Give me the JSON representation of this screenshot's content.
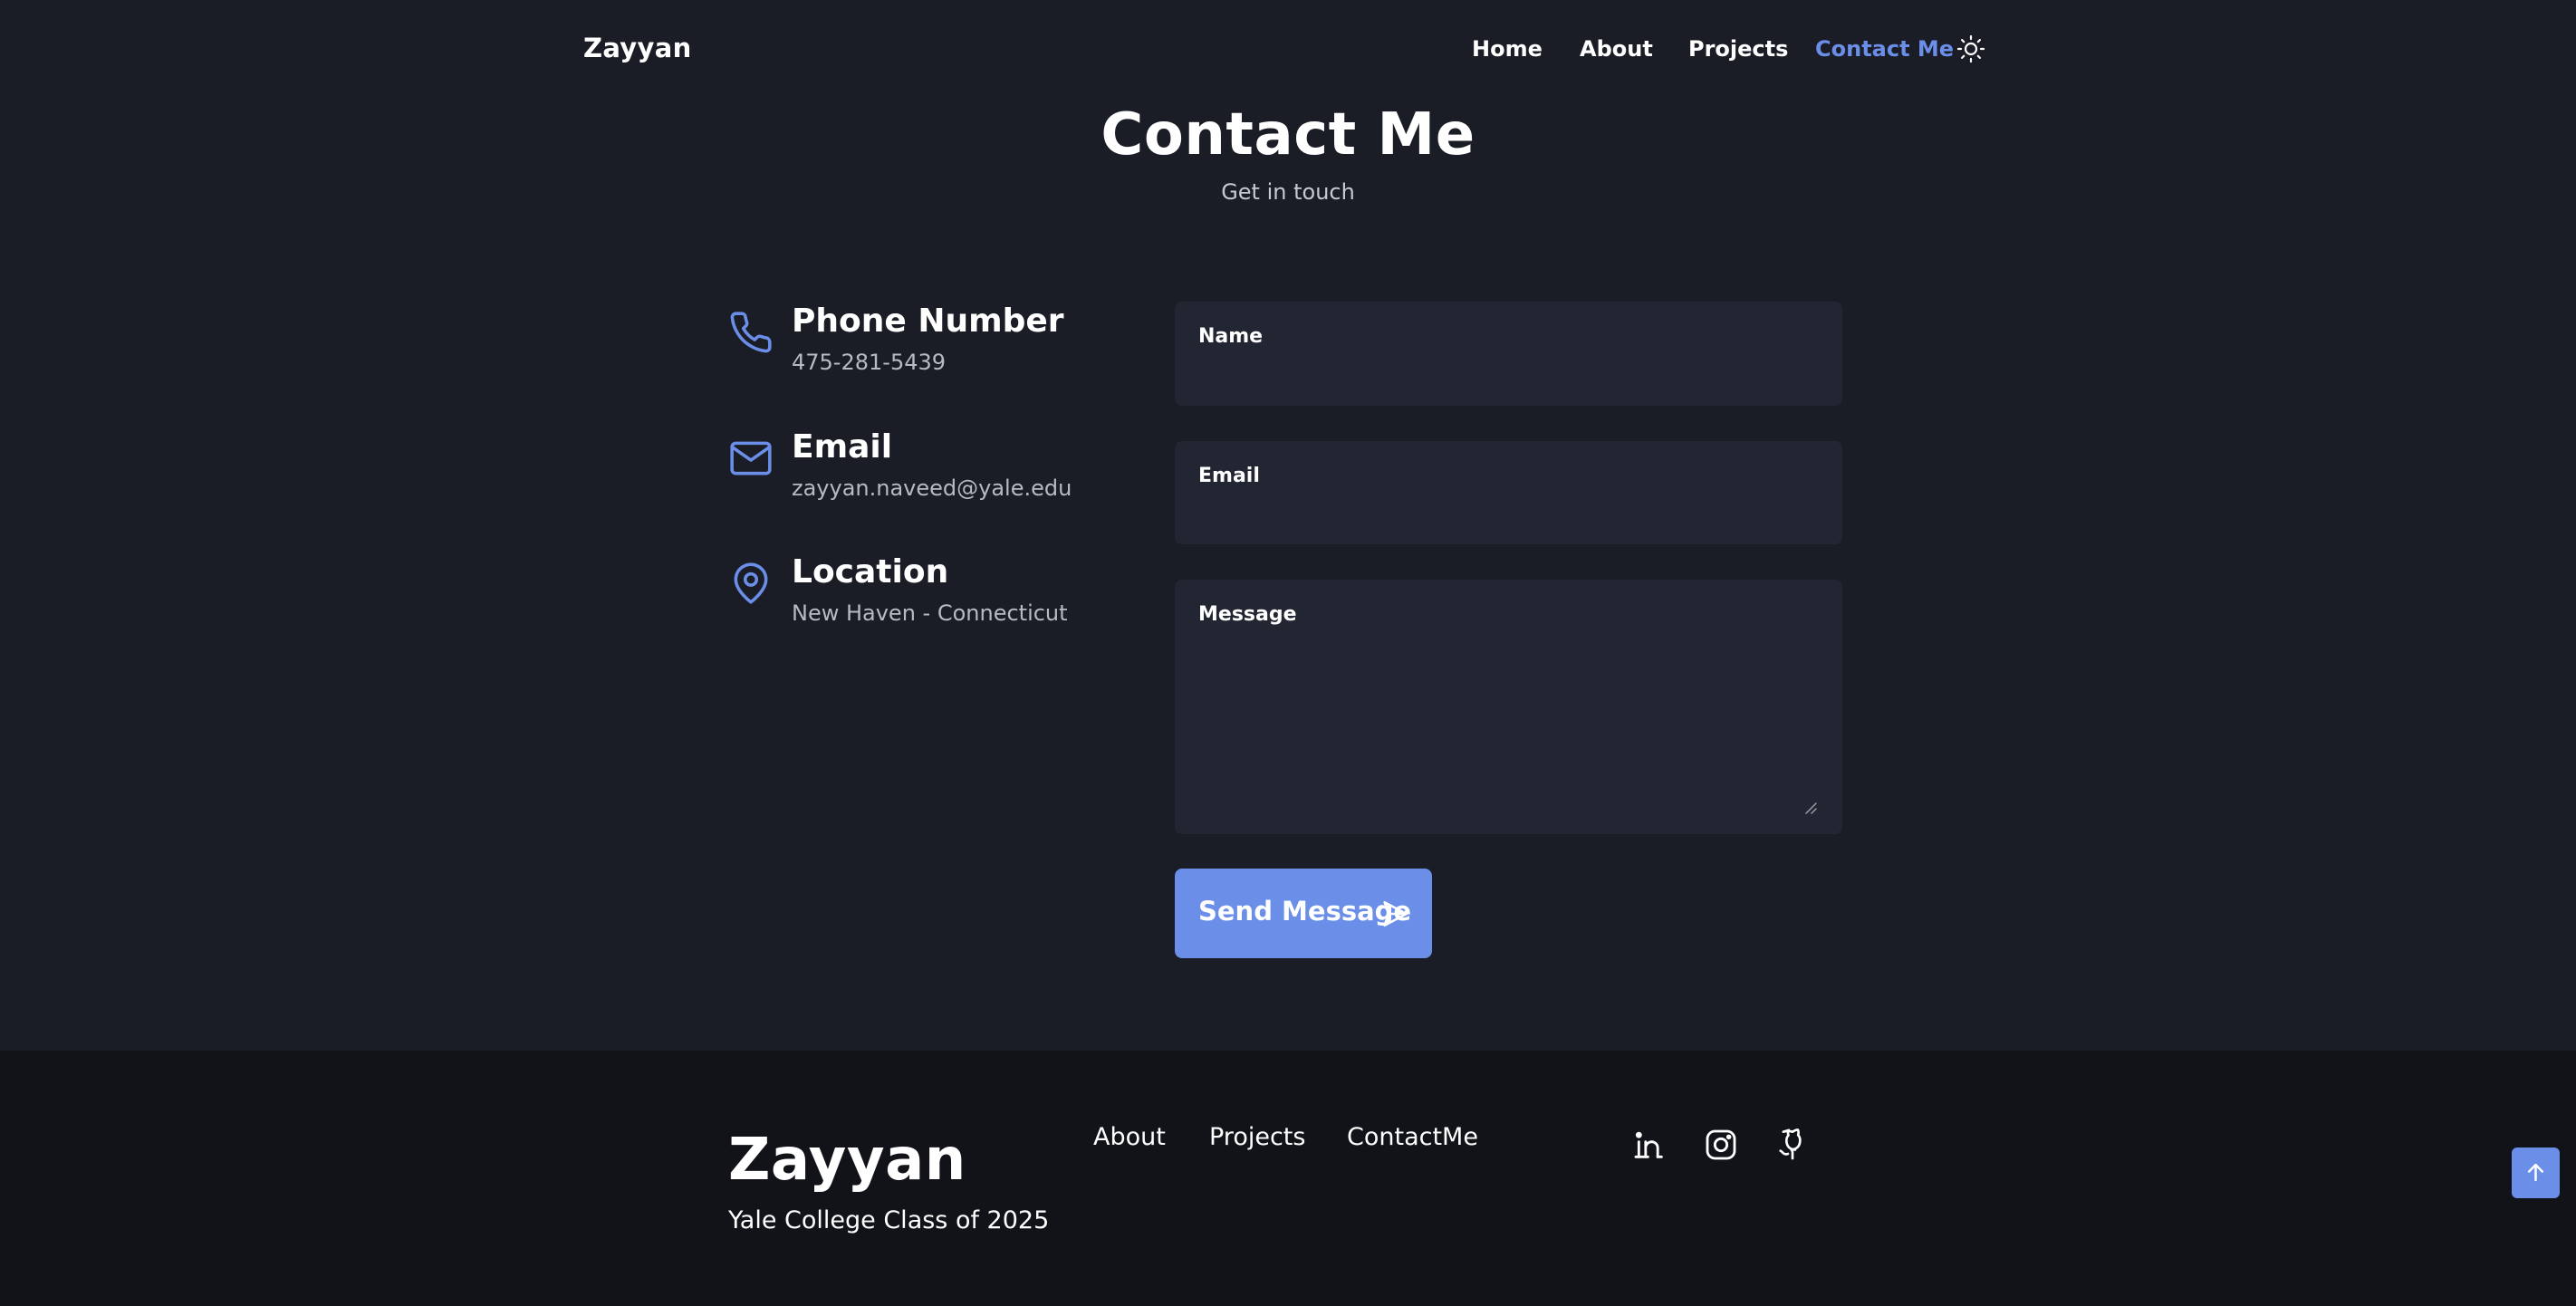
{
  "header": {
    "logo": "Zayyan",
    "nav": [
      {
        "label": "Home",
        "active": false
      },
      {
        "label": "About",
        "active": false
      },
      {
        "label": "Projects",
        "active": false
      },
      {
        "label": "Contact Me",
        "active": true
      }
    ],
    "theme_toggle_icon": "sun-icon"
  },
  "contact": {
    "title": "Contact Me",
    "subtitle": "Get in touch",
    "info": [
      {
        "icon": "phone-icon",
        "title": "Phone Number",
        "value": "475-281-5439"
      },
      {
        "icon": "mail-icon",
        "title": "Email",
        "value": "zayyan.naveed@yale.edu"
      },
      {
        "icon": "map-pin-icon",
        "title": "Location",
        "value": "New Haven - Connecticut"
      }
    ],
    "form": {
      "name_label": "Name",
      "name_value": "",
      "email_label": "Email",
      "email_value": "",
      "message_label": "Message",
      "message_value": "",
      "send_label": "Send Message",
      "send_icon": "send-icon"
    }
  },
  "footer": {
    "logo": "Zayyan",
    "tagline": "Yale College Class of 2025",
    "links": [
      "About",
      "Projects",
      "ContactMe"
    ],
    "socials": [
      "linkedin-icon",
      "instagram-icon",
      "github-icon"
    ],
    "scroll_top_icon": "arrow-up-icon"
  },
  "colors": {
    "background": "#1b1d26",
    "footer_background": "#111319",
    "field_background": "#222633",
    "accent": "#6b8ee8",
    "muted_text": "#b7bac4"
  }
}
